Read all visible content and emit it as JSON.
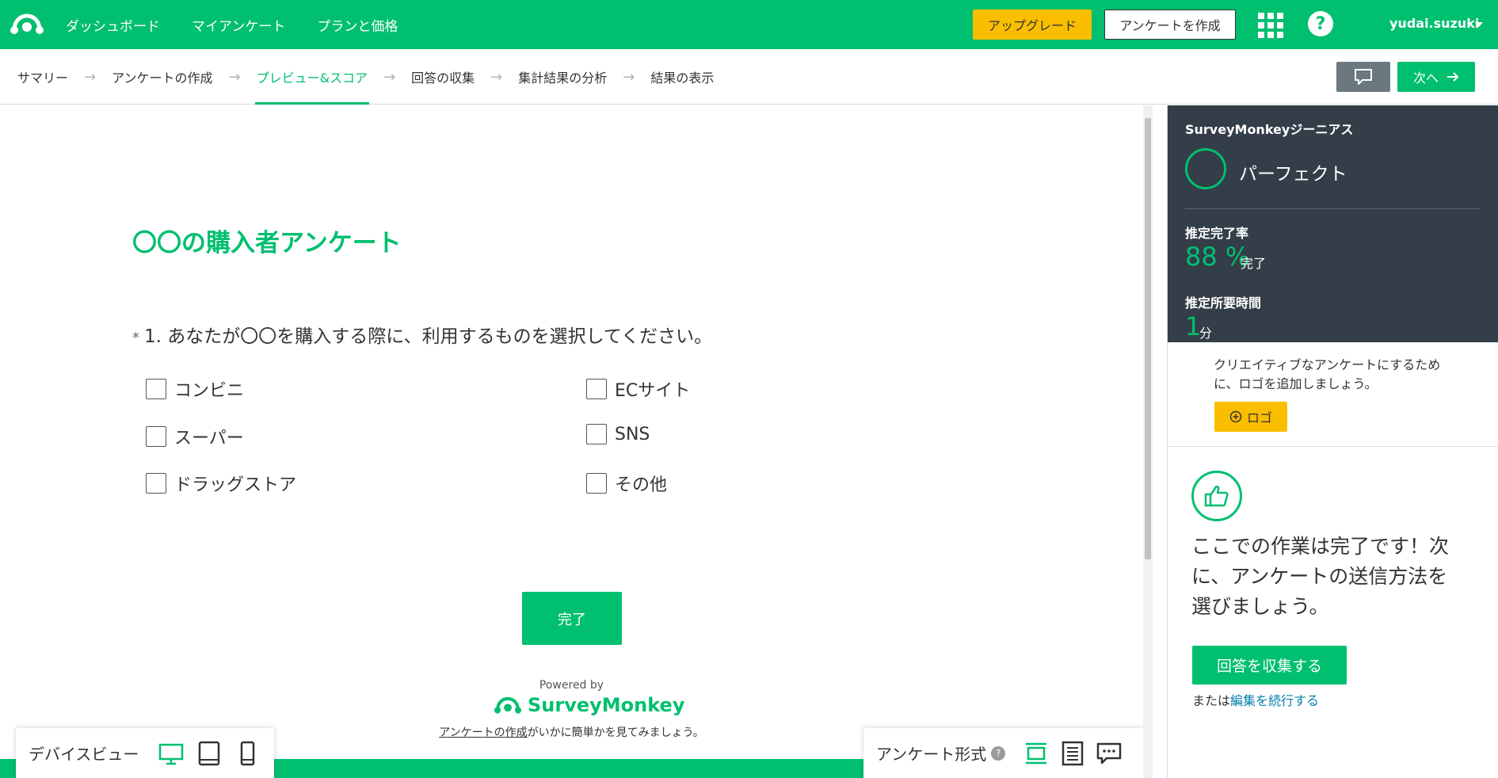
{
  "colors": {
    "brand": "#00bf6f",
    "upgrade": "#f9be00",
    "panel_dark": "#333e48",
    "link": "#007faa"
  },
  "topbar": {
    "logo_icon": "surveymonkey-logo-icon",
    "nav": [
      "ダッシュボード",
      "マイアンケート",
      "プランと価格"
    ],
    "upgrade_label": "アップグレード",
    "create_label": "アンケートを作成",
    "apps_icon": "apps-grid-icon",
    "help_icon": "question-icon",
    "help_glyph": "?",
    "username": "yudai.suzuki"
  },
  "steps": {
    "items": [
      "サマリー",
      "アンケートの作成",
      "プレビュー&スコア",
      "回答の収集",
      "集計結果の分析",
      "結果の表示"
    ],
    "active_index": 2,
    "next_label": "次へ"
  },
  "survey": {
    "title": "〇〇の購入者アンケート",
    "required_mark": "*",
    "question": "1. あなたが〇〇を購入する際に、利用するものを選択してください。",
    "options": [
      "コンビニ",
      "スーパー",
      "ドラッグストア",
      "ECサイト",
      "SNS",
      "その他"
    ],
    "done_label": "完了",
    "powered_by": "Powered by",
    "brand_name": "SurveyMonkey",
    "footer_link": "アンケートの作成",
    "footer_rest": "がいかに簡単かを見てみましょう。"
  },
  "device_view": {
    "label": "デバイスビュー",
    "icons": [
      "desktop-icon",
      "tablet-icon",
      "phone-icon"
    ],
    "active": "desktop-icon"
  },
  "survey_format": {
    "label": "アンケート形式",
    "help_glyph": "?",
    "icons": [
      "one-question-icon",
      "classic-list-icon",
      "conversation-icon"
    ]
  },
  "genius": {
    "title": "SurveyMonkeyジーニアス",
    "status": "パーフェクト",
    "completion_label": "推定完了率",
    "completion_value": "88 %",
    "completion_unit": "完了",
    "time_label": "推定所要時間",
    "time_value": "1",
    "time_unit": "分"
  },
  "logo_tip": {
    "text": "クリエイティブなアンケートにするために、ロゴを追加しましょう。",
    "button_label": "ロゴ"
  },
  "next_step": {
    "message": "ここでの作業は完了です！次に、アンケートの送信方法を選びましょう。",
    "collect_label": "回答を収集する",
    "or_text": "または",
    "edit_link": "編集を続行する"
  }
}
